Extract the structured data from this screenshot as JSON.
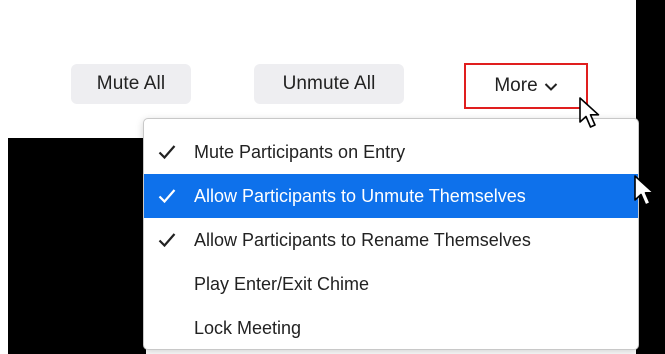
{
  "toolbar": {
    "mute_all_label": "Mute All",
    "unmute_all_label": "Unmute All",
    "more_label": "More"
  },
  "menu": {
    "items": [
      {
        "label": "Mute Participants on Entry",
        "checked": true,
        "highlighted": false
      },
      {
        "label": "Allow Participants to Unmute Themselves",
        "checked": true,
        "highlighted": true
      },
      {
        "label": "Allow Participants to Rename Themselves",
        "checked": true,
        "highlighted": false
      },
      {
        "label": "Play Enter/Exit Chime",
        "checked": false,
        "highlighted": false
      },
      {
        "label": "Lock Meeting",
        "checked": false,
        "highlighted": false
      }
    ]
  },
  "colors": {
    "highlight": "#0e71eb",
    "more_outline": "#e01e1e",
    "button_bg": "#eeeef1"
  },
  "icons": {
    "chevron": "chevron-down-icon",
    "check": "checkmark-icon",
    "cursor": "mouse-pointer-icon"
  }
}
